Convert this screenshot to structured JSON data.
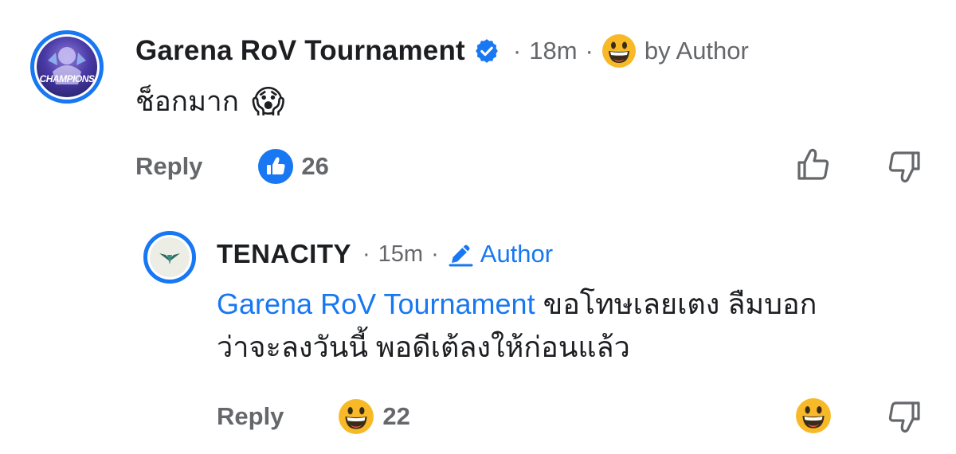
{
  "comment": {
    "author": "Garena RoV Tournament",
    "separator": "·",
    "time": "18m",
    "author_tag": "by Author",
    "author_tag_icon": "grinning-face-emoji-icon",
    "text": "ช็อกมาก",
    "text_emoji": "😱",
    "reply_label": "Reply",
    "reaction_count": "26",
    "reaction_icon": "like-reaction-icon",
    "avatar_text": "CHAMPIONS"
  },
  "reply": {
    "author": "TENACITY",
    "separator": "·",
    "time": "15m",
    "author_badge": "Author",
    "mention": "Garena RoV Tournament",
    "text_line1": " ขอโทษเลยเตง ลืมบอก",
    "text_line2": "ว่าจะลงวันนี้ พอดีเต้ลงให้ก่อนแล้ว",
    "reply_label": "Reply",
    "reaction_count": "22",
    "reaction_icon": "grinning-face-reaction-icon"
  },
  "colors": {
    "accent": "#1877f2",
    "secondary_text": "#65676b",
    "primary_text": "#1c1e21",
    "emoji_yellow": "#f7b928"
  }
}
